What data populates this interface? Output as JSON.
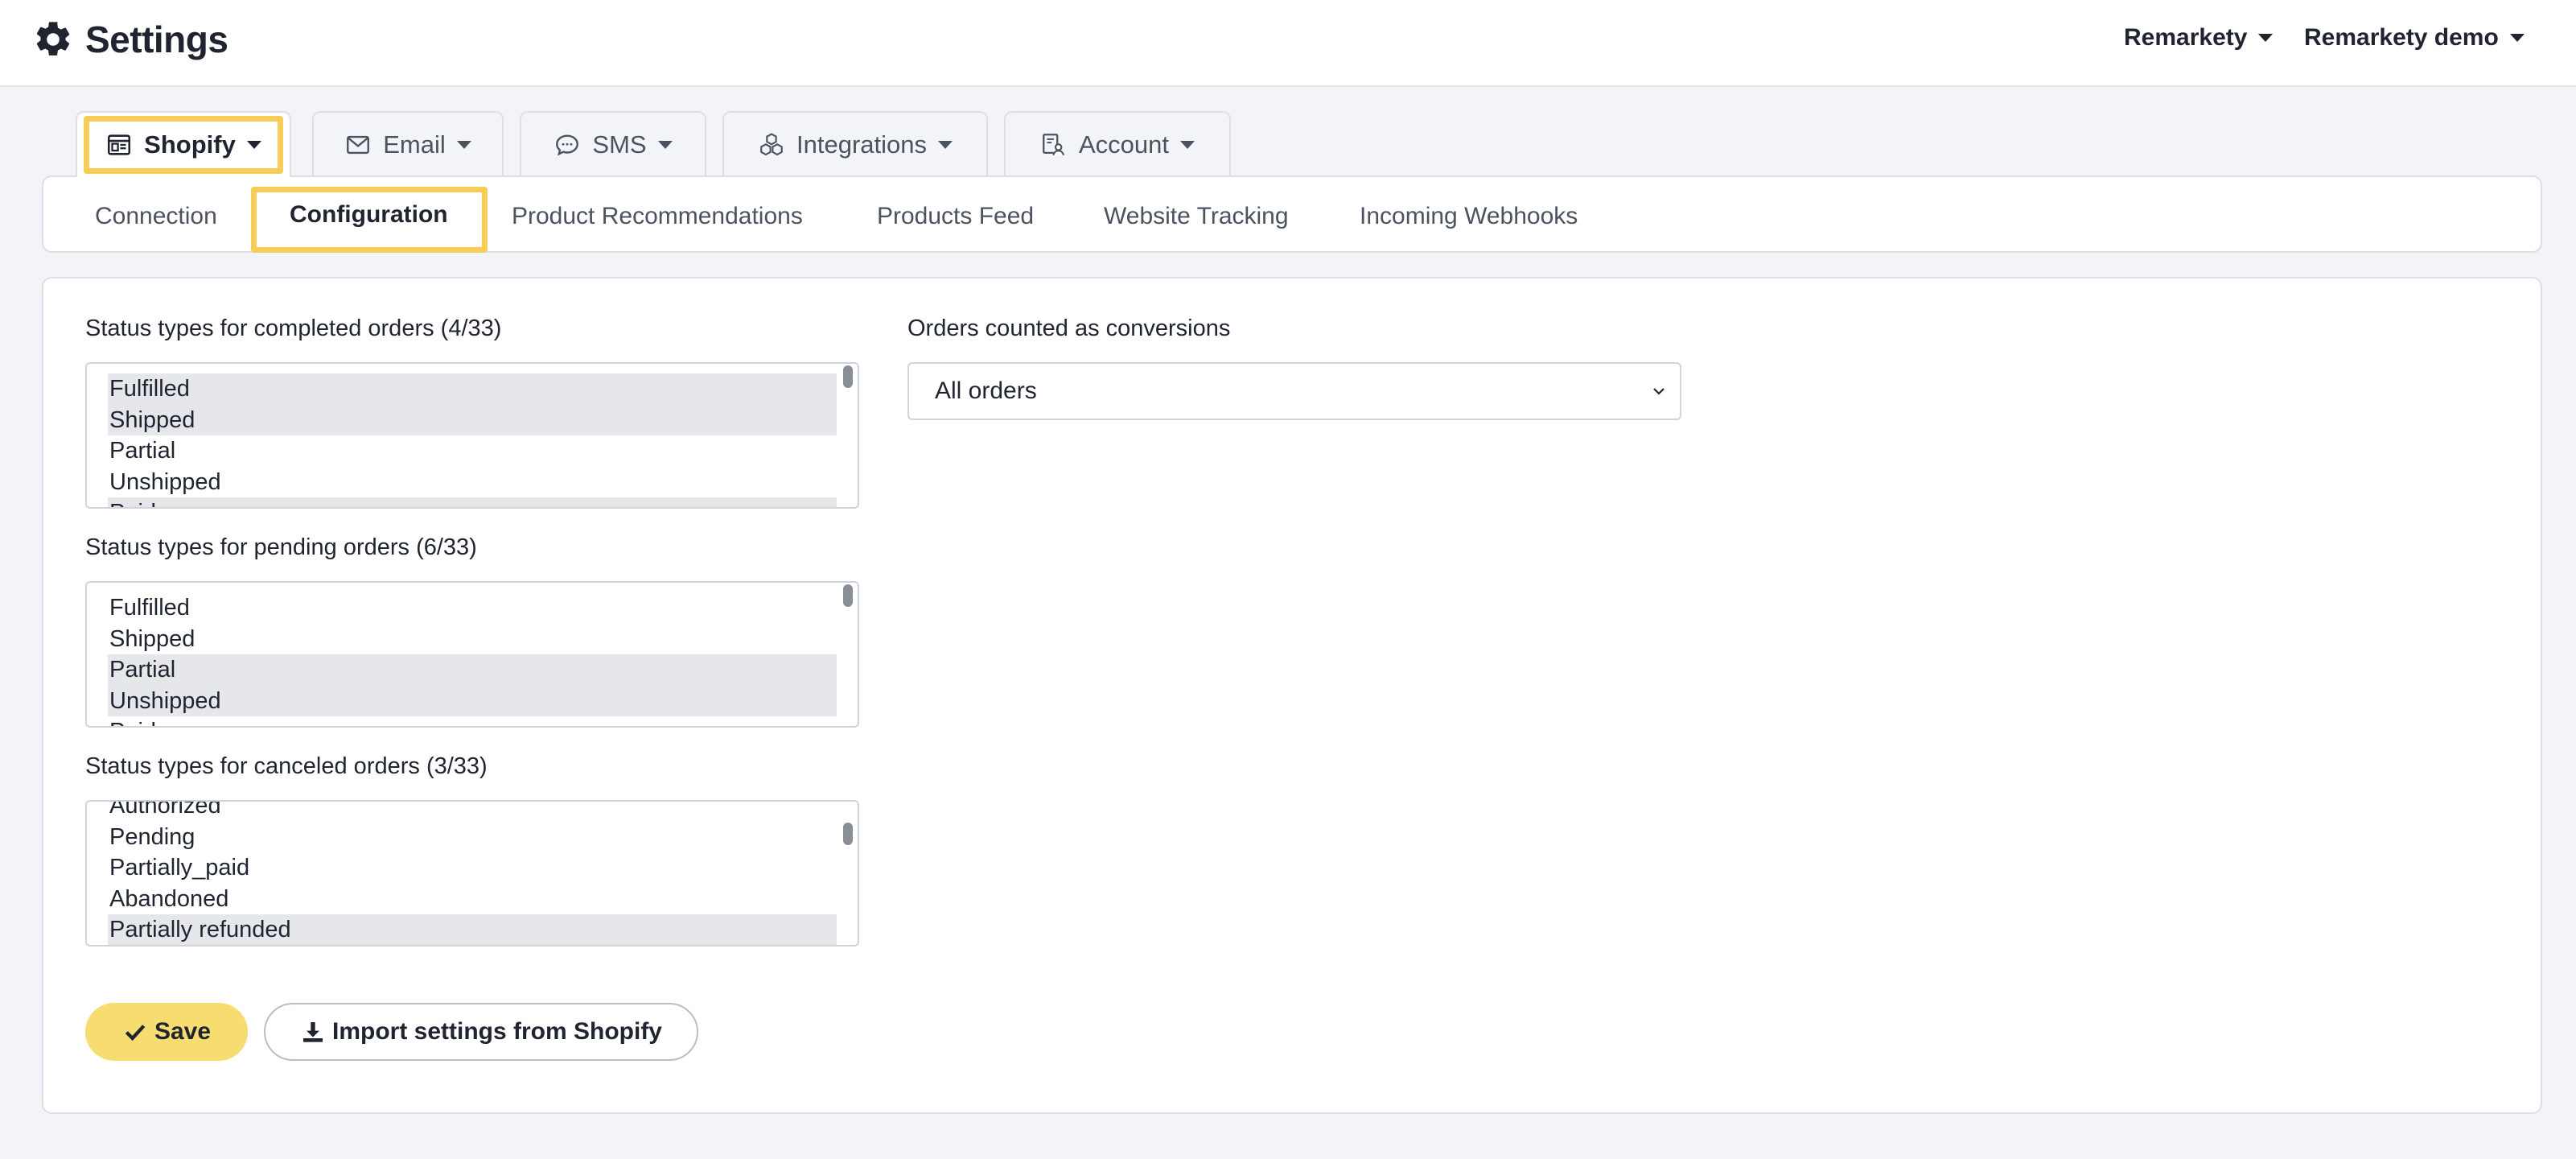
{
  "header": {
    "title": "Settings",
    "icon": "gear-icon",
    "user_menus": [
      "Remarkety",
      "Remarkety demo"
    ]
  },
  "main_tabs": [
    {
      "label": "Shopify",
      "icon": "store-icon",
      "active": true
    },
    {
      "label": "Email",
      "icon": "envelope-icon"
    },
    {
      "label": "SMS",
      "icon": "chat-bubble-icon"
    },
    {
      "label": "Integrations",
      "icon": "cubes-icon"
    },
    {
      "label": "Account",
      "icon": "account-icon"
    }
  ],
  "sub_tabs": [
    {
      "label": "Connection"
    },
    {
      "label": "Configuration",
      "active": true
    },
    {
      "label": "Product Recommendations"
    },
    {
      "label": "Products Feed"
    },
    {
      "label": "Website Tracking"
    },
    {
      "label": "Incoming Webhooks"
    }
  ],
  "form": {
    "completed": {
      "label": "Status types for completed orders (4/33)",
      "options": [
        {
          "text": "Fulfilled",
          "selected": true
        },
        {
          "text": "Shipped",
          "selected": true
        },
        {
          "text": "Partial",
          "selected": false
        },
        {
          "text": "Unshipped",
          "selected": false
        },
        {
          "text": "Paid",
          "selected": true
        }
      ]
    },
    "pending": {
      "label": "Status types for pending orders (6/33)",
      "options": [
        {
          "text": "Fulfilled",
          "selected": false
        },
        {
          "text": "Shipped",
          "selected": false
        },
        {
          "text": "Partial",
          "selected": true
        },
        {
          "text": "Unshipped",
          "selected": true
        },
        {
          "text": "Paid",
          "selected": false
        }
      ]
    },
    "canceled": {
      "label": "Status types for canceled orders (3/33)",
      "options": [
        {
          "text": "Authorized",
          "selected": false
        },
        {
          "text": "Pending",
          "selected": false
        },
        {
          "text": "Partially_paid",
          "selected": false
        },
        {
          "text": "Abandoned",
          "selected": false
        },
        {
          "text": "Partially refunded",
          "selected": true
        }
      ]
    },
    "conversions": {
      "label": "Orders counted as conversions",
      "value": "All orders"
    }
  },
  "buttons": {
    "save": "Save",
    "import": "Import settings from Shopify"
  },
  "colors": {
    "accent": "#f7cd58",
    "save_button": "#f7dc6f",
    "selected_option": "#e6e7ea",
    "page_background": "#f3f4f7"
  }
}
